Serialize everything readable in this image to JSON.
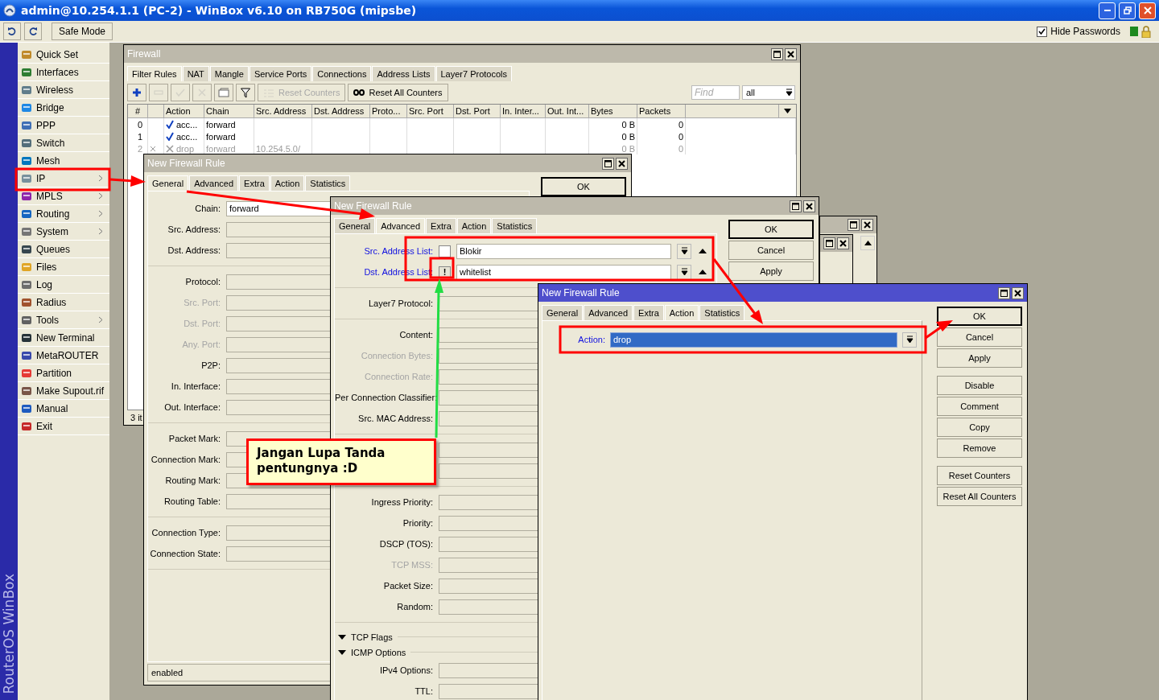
{
  "window": {
    "title": "admin@10.254.1.1 (PC-2) - WinBox v6.10 on RB750G (mipsbe)"
  },
  "toolbar": {
    "safe_mode": "Safe Mode",
    "hide_passwords": {
      "label": "Hide Passwords",
      "checked": true
    }
  },
  "side_label": "RouterOS WinBox",
  "sidebar": {
    "items": [
      {
        "label": "Quick Set",
        "submenu": false
      },
      {
        "label": "Interfaces",
        "submenu": false
      },
      {
        "label": "Wireless",
        "submenu": false
      },
      {
        "label": "Bridge",
        "submenu": false
      },
      {
        "label": "PPP",
        "submenu": false
      },
      {
        "label": "Switch",
        "submenu": false
      },
      {
        "label": "Mesh",
        "submenu": false
      },
      {
        "label": "IP",
        "submenu": true
      },
      {
        "label": "MPLS",
        "submenu": true
      },
      {
        "label": "Routing",
        "submenu": true
      },
      {
        "label": "System",
        "submenu": true
      },
      {
        "label": "Queues",
        "submenu": false
      },
      {
        "label": "Files",
        "submenu": false
      },
      {
        "label": "Log",
        "submenu": false
      },
      {
        "label": "Radius",
        "submenu": false
      },
      {
        "label": "Tools",
        "submenu": true
      },
      {
        "label": "New Terminal",
        "submenu": false
      },
      {
        "label": "MetaROUTER",
        "submenu": false
      },
      {
        "label": "Partition",
        "submenu": false
      },
      {
        "label": "Make Supout.rif",
        "submenu": false
      },
      {
        "label": "Manual",
        "submenu": false
      },
      {
        "label": "Exit",
        "submenu": false
      }
    ]
  },
  "firewall": {
    "title": "Firewall",
    "tabs": [
      {
        "label": "Filter Rules",
        "selected": true
      },
      {
        "label": "NAT",
        "selected": false
      },
      {
        "label": "Mangle",
        "selected": false
      },
      {
        "label": "Service Ports",
        "selected": false
      },
      {
        "label": "Connections",
        "selected": false
      },
      {
        "label": "Address Lists",
        "selected": false
      },
      {
        "label": "Layer7 Protocols",
        "selected": false
      }
    ],
    "tools": [
      {
        "kind": "add",
        "disabled": false
      },
      {
        "kind": "remove",
        "disabled": true
      },
      {
        "kind": "enable",
        "disabled": true
      },
      {
        "kind": "disable",
        "disabled": true
      },
      {
        "kind": "comment",
        "disabled": false
      },
      {
        "kind": "filter",
        "disabled": false
      },
      {
        "kind": "reset",
        "label": "Reset Counters",
        "disabled": true
      },
      {
        "kind": "reset_all",
        "label": "Reset All Counters",
        "disabled": false
      }
    ],
    "find": {
      "placeholder": "Find"
    },
    "filter": "all",
    "columns": [
      "#",
      "Action",
      "Chain",
      "Src. Address",
      "Dst. Address",
      "Proto...",
      "Src. Port",
      "Dst. Port",
      "In. Inter...",
      "Out. Int...",
      "Bytes",
      "Packets"
    ],
    "rows": [
      {
        "number": "0",
        "kind": "accept",
        "action": "acc...",
        "chain": "forward",
        "bytes": "0 B",
        "packets": "0",
        "disabled": false
      },
      {
        "number": "1",
        "kind": "accept",
        "action": "acc...",
        "chain": "forward",
        "bytes": "0 B",
        "packets": "0",
        "disabled": false
      },
      {
        "number": "2",
        "kind": "drop",
        "action": "drop",
        "chain": "forward",
        "src": "10.254.5.0/",
        "bytes": "0 B",
        "packets": "0",
        "disabled": true
      }
    ],
    "status": "3 it"
  },
  "general_window": {
    "title": "New Firewall Rule",
    "tabs": [
      {
        "label": "General",
        "selected": true
      },
      {
        "label": "Advanced",
        "selected": false
      },
      {
        "label": "Extra",
        "selected": false
      },
      {
        "label": "Action",
        "selected": false
      },
      {
        "label": "Statistics",
        "selected": false
      }
    ],
    "sections": [
      [
        {
          "label": "Chain:",
          "value": "forward",
          "disabled": false
        },
        {
          "label": "Src. Address:",
          "disabled": false
        },
        {
          "label": "Dst. Address:",
          "disabled": false
        }
      ],
      [
        {
          "label": "Protocol:",
          "disabled": false
        },
        {
          "label": "Src. Port:",
          "disabled": true
        },
        {
          "label": "Dst. Port:",
          "disabled": true
        },
        {
          "label": "Any. Port:",
          "disabled": true
        },
        {
          "label": "P2P:",
          "disabled": false
        },
        {
          "label": "In. Interface:",
          "disabled": false
        },
        {
          "label": "Out. Interface:",
          "disabled": false
        }
      ],
      [
        {
          "label": "Packet Mark:",
          "disabled": false
        },
        {
          "label": "Connection Mark:",
          "disabled": false
        },
        {
          "label": "Routing Mark:",
          "disabled": false
        },
        {
          "label": "Routing Table:",
          "disabled": false
        }
      ],
      [
        {
          "label": "Connection Type:",
          "disabled": false
        },
        {
          "label": "Connection State:",
          "disabled": false
        }
      ]
    ],
    "buttons": [
      {
        "label": "OK",
        "default": true
      }
    ],
    "status": "enabled"
  },
  "advanced_window": {
    "title": "New Firewall Rule",
    "tabs": [
      {
        "label": "General",
        "selected": false
      },
      {
        "label": "Advanced",
        "selected": true
      },
      {
        "label": "Extra",
        "selected": false
      },
      {
        "label": "Action",
        "selected": false
      },
      {
        "label": "Statistics",
        "selected": false
      }
    ],
    "sections": [
      [
        {
          "label": "Src. Address List:",
          "kind": "address_list",
          "value": "Blokir",
          "invert": false,
          "disabled": false
        },
        {
          "label": "Dst. Address List:",
          "kind": "address_list",
          "value": "whitelist",
          "invert": true,
          "invert_mark": "!",
          "disabled": false
        }
      ],
      [
        {
          "label": "Layer7 Protocol:",
          "kind": "text",
          "disabled": false
        }
      ],
      [
        {
          "label": "Content:",
          "kind": "text",
          "disabled": false
        },
        {
          "label": "Connection Bytes:",
          "kind": "text",
          "disabled": true
        },
        {
          "label": "Connection Rate:",
          "kind": "text",
          "disabled": true
        },
        {
          "label": "Per Connection Classifier:",
          "kind": "text",
          "disabled": false
        },
        {
          "label": "Src. MAC Address:",
          "kind": "text",
          "disabled": false
        }
      ],
      [
        {
          "kind": "text"
        },
        {
          "kind": "text"
        }
      ],
      [
        {
          "label": "Ingress Priority:",
          "kind": "text",
          "disabled": false
        },
        {
          "label": "Priority:",
          "kind": "text",
          "disabled": false
        },
        {
          "label": "DSCP (TOS):",
          "kind": "text",
          "disabled": false
        },
        {
          "label": "TCP MSS:",
          "kind": "text",
          "disabled": true
        },
        {
          "label": "Packet Size:",
          "kind": "text",
          "disabled": false
        },
        {
          "label": "Random:",
          "kind": "text",
          "disabled": false
        }
      ]
    ],
    "groups": [
      "TCP Flags",
      "ICMP Options"
    ],
    "tail": [
      {
        "label": "IPv4 Options:",
        "disabled": false
      },
      {
        "label": "TTL:",
        "disabled": false
      }
    ],
    "buttons": [
      {
        "label": "OK",
        "default": true
      },
      {
        "label": "Cancel",
        "default": false
      },
      {
        "label": "Apply",
        "default": false
      }
    ]
  },
  "action_window": {
    "title": "New Firewall Rule",
    "tabs": [
      {
        "label": "General",
        "selected": false
      },
      {
        "label": "Advanced",
        "selected": false
      },
      {
        "label": "Extra",
        "selected": false
      },
      {
        "label": "Action",
        "selected": true
      },
      {
        "label": "Statistics",
        "selected": false
      }
    ],
    "field": {
      "label": "Action:",
      "value": "drop"
    },
    "button_groups": [
      [
        {
          "label": "OK",
          "default": true
        },
        {
          "label": "Cancel",
          "default": false
        },
        {
          "label": "Apply",
          "default": false
        }
      ],
      [
        {
          "label": "Disable",
          "default": false
        },
        {
          "label": "Comment",
          "default": false
        },
        {
          "label": "Copy",
          "default": false
        },
        {
          "label": "Remove",
          "default": false
        }
      ],
      [
        {
          "label": "Reset Counters",
          "default": false
        },
        {
          "label": "Reset All Counters",
          "default": false
        }
      ]
    ]
  },
  "note": {
    "text": "Jangan Lupa Tanda pentungnya :D"
  }
}
